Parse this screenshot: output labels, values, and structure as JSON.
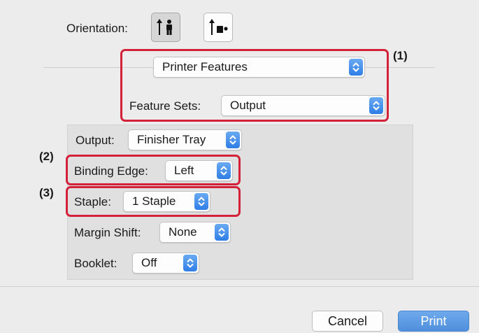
{
  "orientation": {
    "label": "Orientation:"
  },
  "panel_popup": {
    "value": "Printer Features"
  },
  "feature_sets": {
    "label": "Feature Sets:",
    "value": "Output"
  },
  "options": {
    "output": {
      "label": "Output:",
      "value": "Finisher Tray"
    },
    "binding_edge": {
      "label": "Binding Edge:",
      "value": "Left"
    },
    "staple": {
      "label": "Staple:",
      "value": "1 Staple"
    },
    "margin_shift": {
      "label": "Margin Shift:",
      "value": "None"
    },
    "booklet": {
      "label": "Booklet:",
      "value": "Off"
    }
  },
  "callouts": [
    "(1)",
    "(2)",
    "(3)"
  ],
  "buttons": {
    "cancel": "Cancel",
    "print": "Print"
  },
  "colors": {
    "callout": "#d4213a",
    "accent": "#2f7ee6",
    "print_button": "#5b9be3"
  },
  "icons": {
    "portrait": "portrait-orientation-icon",
    "landscape": "landscape-orientation-icon",
    "stepper": "up-down-chevron-icon"
  }
}
